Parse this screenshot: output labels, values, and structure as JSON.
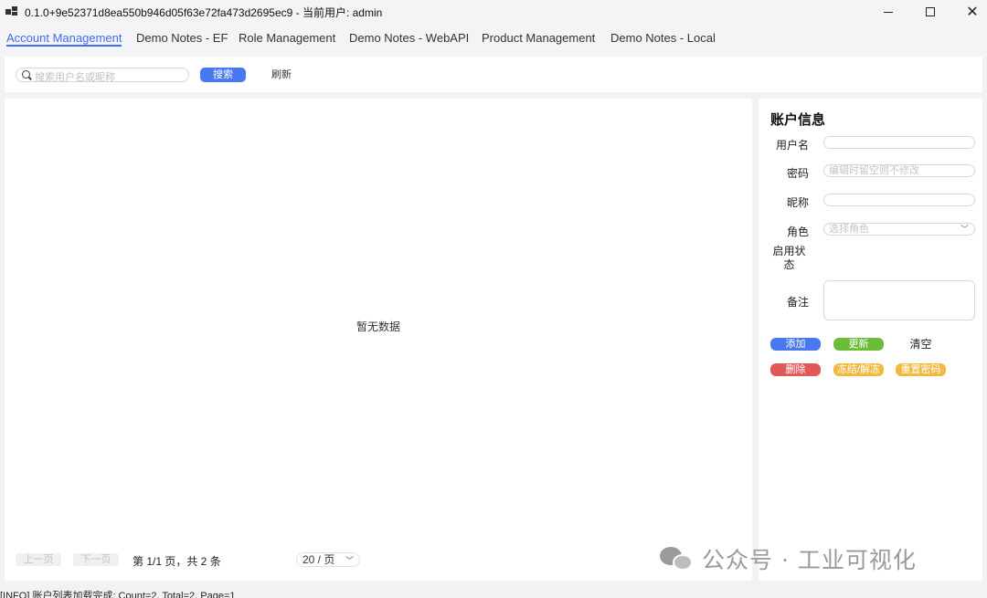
{
  "window": {
    "title": "0.1.0+9e52371d8ea550b946d05f63e72fa473d2695ec9 - 当前用户: admin",
    "close_glyph": "✕"
  },
  "tabs": [
    {
      "label": "Account Management",
      "active": true
    },
    {
      "label": "Demo Notes - EF",
      "active": false
    },
    {
      "label": "Role Management",
      "active": false
    },
    {
      "label": "Demo Notes - WebAPI",
      "active": false
    },
    {
      "label": "Product Management",
      "active": false
    },
    {
      "label": "Demo Notes - Local",
      "active": false
    }
  ],
  "search": {
    "placeholder": "搜索用户名或昵称",
    "search_label": "搜索",
    "refresh_label": "刷新"
  },
  "list": {
    "empty_text": "暂无数据",
    "prev_label": "上一页",
    "next_label": "下一页",
    "page_info": "第 1/1 页，共 2 条",
    "page_size": "20 / 页"
  },
  "detail": {
    "title": "账户信息",
    "username_label": "用户名",
    "username_value": "",
    "password_label": "密码",
    "password_placeholder": "编辑时留空则不修改",
    "nickname_label": "昵称",
    "nickname_value": "",
    "role_label": "角色",
    "role_placeholder": "选择角色",
    "status_label": "启用状态",
    "remark_label": "备注",
    "remark_value": ""
  },
  "actions": {
    "add": "添加",
    "update": "更新",
    "clear": "清空",
    "delete": "删除",
    "freeze": "冻结/解冻",
    "reset_password": "重置密码"
  },
  "status_bar": "[INFO] 账户列表加载完成: Count=2, Total=2, Page=1",
  "watermark": "公众号 · 工业可视化",
  "colors": {
    "accent": "#4a78ee",
    "success": "#6abc3a",
    "danger": "#e05858",
    "warning": "#f2b940"
  }
}
